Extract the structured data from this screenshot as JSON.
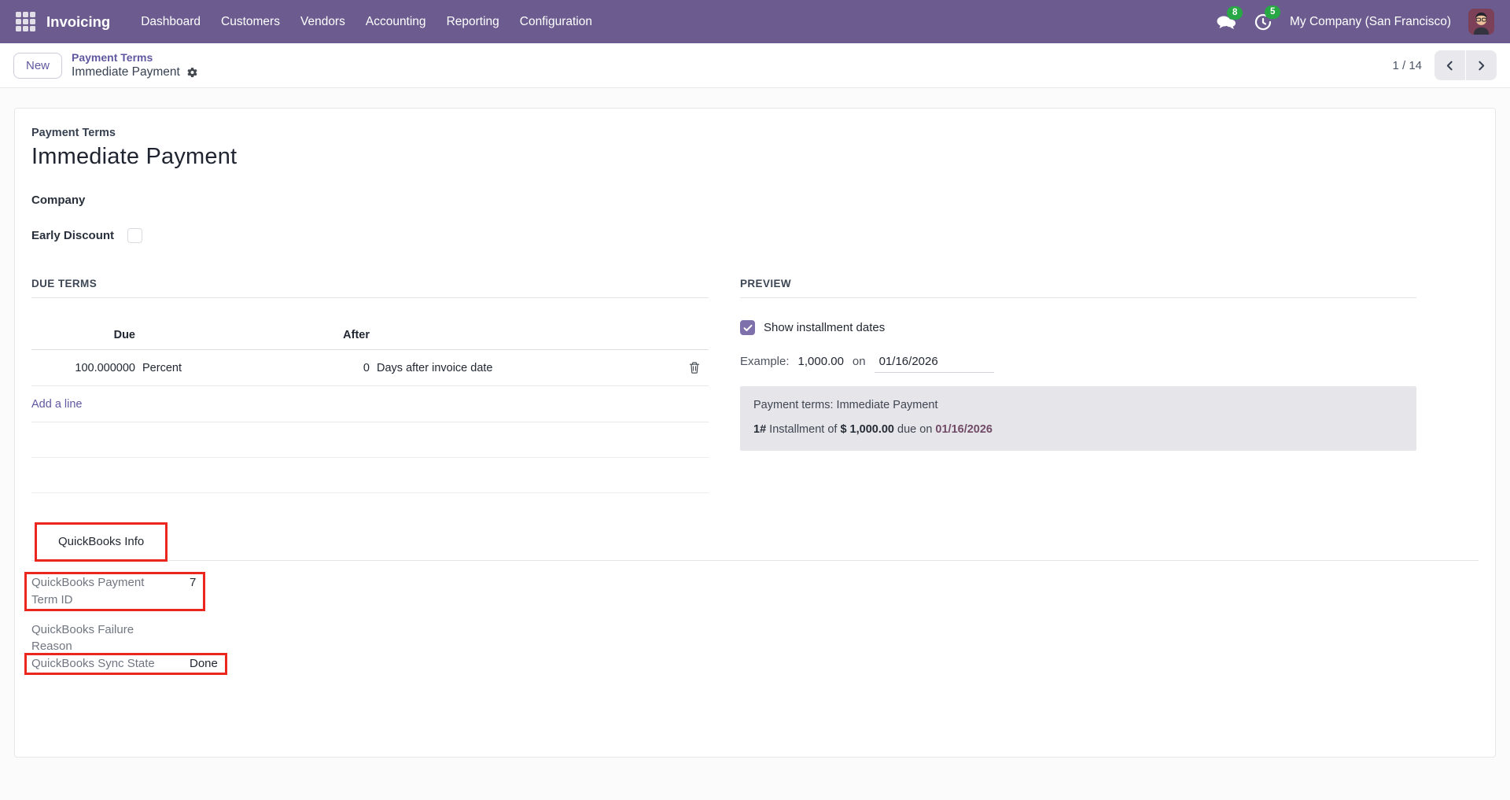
{
  "nav": {
    "app_name": "Invoicing",
    "items": [
      "Dashboard",
      "Customers",
      "Vendors",
      "Accounting",
      "Reporting",
      "Configuration"
    ],
    "messages_badge": "8",
    "activities_badge": "5",
    "company": "My Company (San Francisco)"
  },
  "control_panel": {
    "new_button": "New",
    "breadcrumb_parent": "Payment Terms",
    "breadcrumb_current": "Immediate Payment",
    "pager_count": "1 / 14"
  },
  "form": {
    "name_label": "Payment Terms",
    "name_value": "Immediate Payment",
    "company_label": "Company",
    "early_discount_label": "Early Discount"
  },
  "due_terms": {
    "section_title": "DUE TERMS",
    "col_due": "Due",
    "col_after": "After",
    "row": {
      "due_value": "100.000000",
      "due_unit": "Percent",
      "after_value": "0",
      "after_unit": "Days after invoice date"
    },
    "add_line": "Add a line"
  },
  "preview": {
    "section_title": "PREVIEW",
    "show_installment_label": "Show installment dates",
    "example_label": "Example:",
    "example_amount": "1,000.00",
    "example_on": "on",
    "example_date": "01/16/2026",
    "summary_line": "Payment terms: Immediate Payment",
    "installment_prefix": "1#",
    "installment_text": "Installment of",
    "installment_amount": "$ 1,000.00",
    "installment_due_on": "due on",
    "installment_date": "01/16/2026"
  },
  "quickbooks": {
    "tab_label": "QuickBooks Info",
    "fields": [
      {
        "label": "QuickBooks Payment Term ID",
        "value": "7"
      },
      {
        "label": "QuickBooks Failure Reason",
        "value": ""
      },
      {
        "label": "QuickBooks Sync State",
        "value": "Done"
      }
    ]
  },
  "colors": {
    "navbar": "#6b5b8e",
    "accent_link": "#5f58a0",
    "badge_green": "#28a745",
    "installment_date": "#714b67",
    "annotation_red": "#ea261f",
    "preview_panel": "#e6e5e9"
  }
}
